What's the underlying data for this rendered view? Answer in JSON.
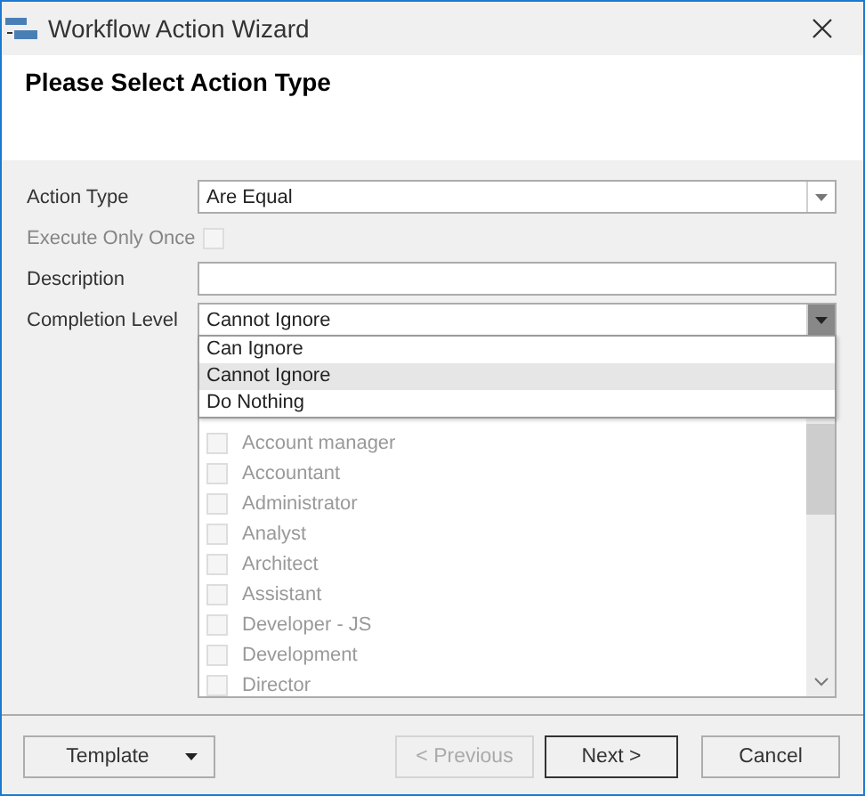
{
  "window": {
    "title": "Workflow Action Wizard"
  },
  "header": {
    "title": "Please Select Action Type"
  },
  "fields": [
    {
      "kind": "combo",
      "label": "Action Type",
      "value": "Are Equal",
      "expanded": false,
      "disabled": false
    },
    {
      "kind": "checkbox",
      "label": "Execute Only Once",
      "checked": false,
      "disabled": true
    },
    {
      "kind": "text",
      "label": "Description",
      "disabled": false
    },
    {
      "kind": "combo",
      "label": "Completion Level",
      "value": "Cannot Ignore",
      "expanded": true,
      "disabled": false
    }
  ],
  "dropdown": {
    "options": [
      {
        "label": "Can Ignore",
        "selected": false
      },
      {
        "label": "Cannot Ignore",
        "selected": true
      },
      {
        "label": "Do Nothing",
        "selected": false
      }
    ]
  },
  "roles": [
    {
      "label": "Account manager",
      "checked": false,
      "disabled": true
    },
    {
      "label": "Accountant",
      "checked": false,
      "disabled": true
    },
    {
      "label": "Administrator",
      "checked": false,
      "disabled": true
    },
    {
      "label": "Analyst",
      "checked": false,
      "disabled": true
    },
    {
      "label": "Architect",
      "checked": false,
      "disabled": true
    },
    {
      "label": "Assistant",
      "checked": false,
      "disabled": true
    },
    {
      "label": "Developer - JS",
      "checked": false,
      "disabled": true
    },
    {
      "label": "Development",
      "checked": false,
      "disabled": true
    },
    {
      "label": "Director",
      "checked": false,
      "disabled": true
    }
  ],
  "buttons": [
    {
      "kind": "split",
      "label": "Template",
      "disabled": false,
      "default": false
    },
    {
      "kind": "plain",
      "label": "< Previous",
      "disabled": true,
      "default": false
    },
    {
      "kind": "plain",
      "label": "Next >",
      "disabled": false,
      "default": true
    },
    {
      "kind": "plain",
      "label": "Cancel",
      "disabled": false,
      "default": false
    }
  ]
}
